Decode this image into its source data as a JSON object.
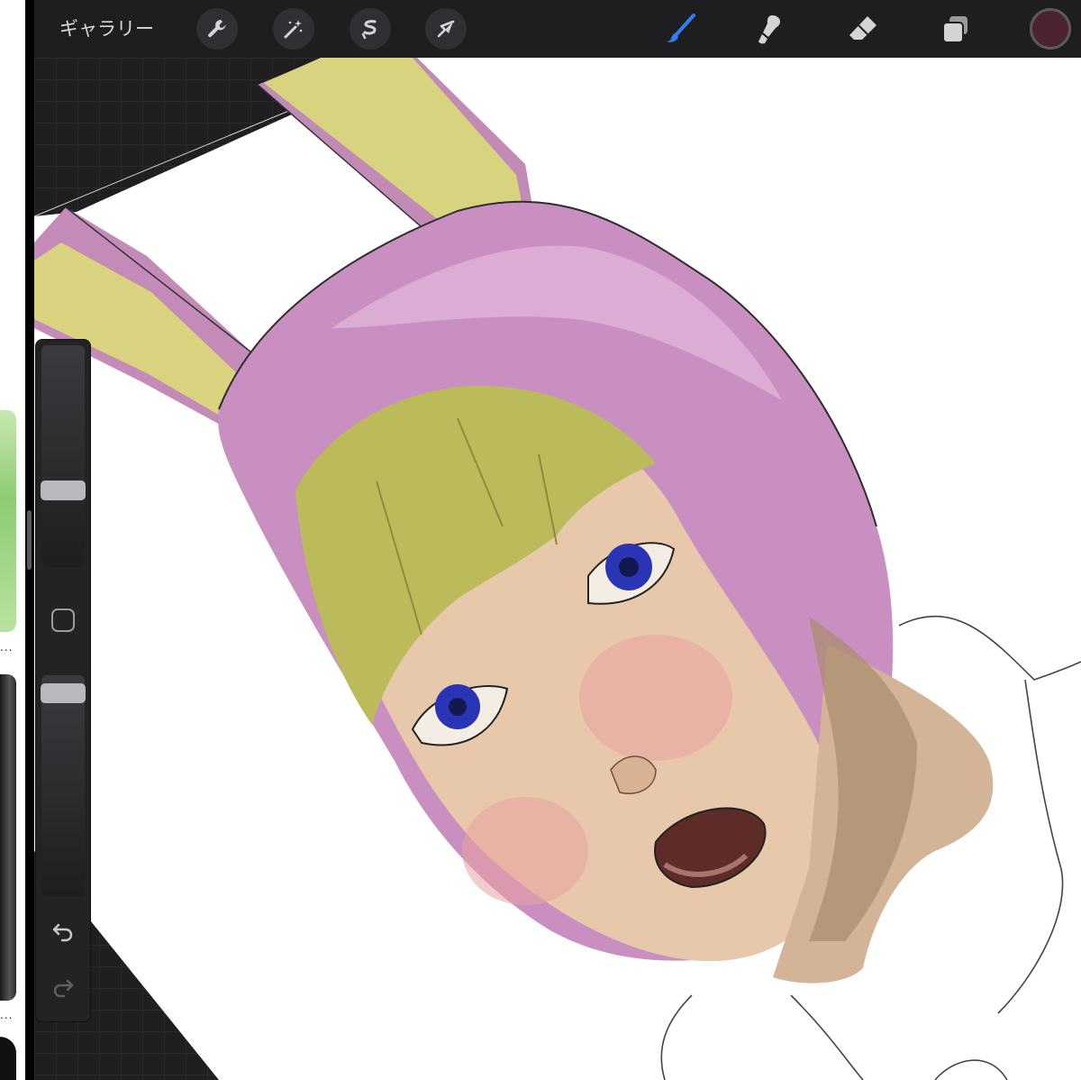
{
  "toolbar": {
    "gallery_label": "ギャラリー",
    "left_tools": [
      "wrench-icon",
      "magic-wand-icon",
      "selection-icon",
      "transform-arrow-icon"
    ],
    "right_tools": [
      "brush-icon",
      "smudge-icon",
      "eraser-icon",
      "layers-icon"
    ],
    "active_tool": "brush",
    "accent_color": "#2f7ef5",
    "current_color": "#4a2231"
  },
  "sidebar": {
    "brush_size_level": 0.33,
    "opacity_level": 0.96,
    "modify_button_icon": "square-icon",
    "undo_icon": "undo-icon",
    "redo_icon": "redo-icon"
  },
  "left_panel": {
    "ellipsis": "..."
  },
  "colors": {
    "hood": "#c98fc0",
    "ears_inner": "#d6d27e",
    "hair": "#b8b85a",
    "skin": "#e7c6a8",
    "neck": "#d3b496",
    "eyes": "#2a35b5"
  }
}
